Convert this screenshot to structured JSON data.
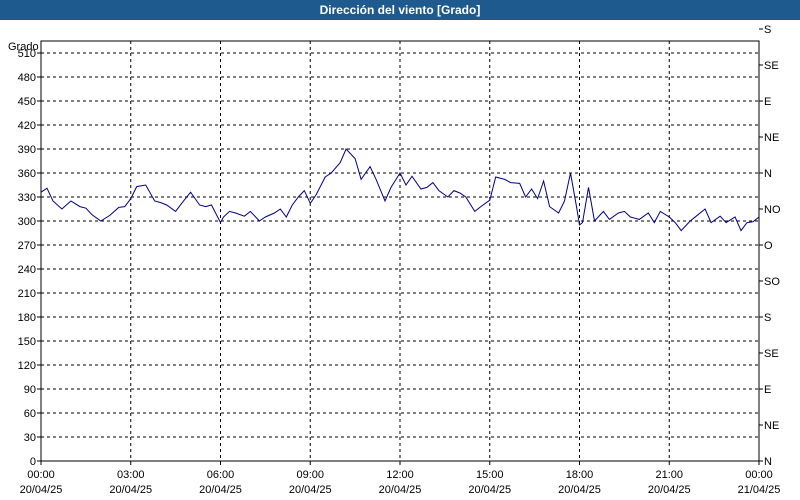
{
  "window": {
    "title": "Dirección del viento [Grado]"
  },
  "chart_data": {
    "type": "line",
    "title": "Dirección del viento [Grado]",
    "ylabel": "Grado",
    "ylim": [
      0,
      525
    ],
    "yticks": [
      0,
      30,
      60,
      90,
      120,
      150,
      180,
      210,
      240,
      270,
      300,
      330,
      360,
      390,
      420,
      450,
      480,
      510
    ],
    "right_ticks": [
      "N",
      "NE",
      "E",
      "SE",
      "S",
      "SO",
      "O",
      "NO",
      "N",
      "NE",
      "E",
      "SE",
      "S"
    ],
    "xlim": [
      "20/04/25 00:00",
      "21/04/25 00:00"
    ],
    "xticks": [
      {
        "time": "00:00",
        "date": "20/04/25"
      },
      {
        "time": "03:00",
        "date": "20/04/25"
      },
      {
        "time": "06:00",
        "date": "20/04/25"
      },
      {
        "time": "09:00",
        "date": "20/04/25"
      },
      {
        "time": "12:00",
        "date": "20/04/25"
      },
      {
        "time": "15:00",
        "date": "20/04/25"
      },
      {
        "time": "18:00",
        "date": "20/04/25"
      },
      {
        "time": "21:00",
        "date": "20/04/25"
      },
      {
        "time": "00:00",
        "date": "21/04/25"
      }
    ],
    "grid": true,
    "series": [
      {
        "color": "#00008b",
        "x_hours": [
          0,
          0.2,
          0.4,
          0.7,
          1.0,
          1.3,
          1.5,
          1.7,
          2.0,
          2.3,
          2.6,
          2.8,
          3.0,
          3.2,
          3.5,
          3.8,
          4.0,
          4.2,
          4.5,
          4.7,
          5.0,
          5.3,
          5.5,
          5.7,
          6.0,
          6.1,
          6.3,
          6.5,
          6.8,
          7.0,
          7.3,
          7.5,
          7.8,
          8.0,
          8.2,
          8.4,
          8.6,
          8.8,
          9.0,
          9.2,
          9.5,
          9.7,
          10.0,
          10.2,
          10.5,
          10.7,
          11.0,
          11.2,
          11.5,
          11.7,
          12.0,
          12.2,
          12.4,
          12.7,
          12.9,
          13.1,
          13.3,
          13.6,
          13.8,
          14.0,
          14.2,
          14.5,
          14.7,
          15.0,
          15.2,
          15.5,
          15.7,
          16.0,
          16.2,
          16.4,
          16.6,
          16.8,
          17.0,
          17.3,
          17.5,
          17.7,
          17.9,
          18.0,
          18.1,
          18.3,
          18.5,
          18.8,
          19.0,
          19.3,
          19.5,
          19.7,
          20.0,
          20.3,
          20.5,
          20.7,
          21.0,
          21.2,
          21.4,
          21.7,
          21.9,
          22.2,
          22.4,
          22.7,
          22.9,
          23.2,
          23.4,
          23.6,
          23.8,
          24.0
        ],
        "values": [
          336,
          341,
          325,
          315,
          325,
          318,
          316,
          308,
          300,
          307,
          317,
          318,
          328,
          343,
          345,
          325,
          323,
          320,
          312,
          322,
          336,
          320,
          318,
          320,
          298,
          305,
          312,
          310,
          306,
          312,
          300,
          305,
          310,
          315,
          305,
          320,
          330,
          338,
          322,
          333,
          355,
          360,
          373,
          390,
          378,
          352,
          368,
          352,
          325,
          342,
          360,
          345,
          356,
          340,
          342,
          348,
          338,
          330,
          338,
          335,
          330,
          312,
          318,
          326,
          355,
          352,
          348,
          347,
          330,
          340,
          328,
          350,
          318,
          310,
          325,
          360,
          318,
          295,
          298,
          342,
          300,
          312,
          302,
          310,
          312,
          305,
          302,
          310,
          298,
          312,
          305,
          298,
          288,
          300,
          306,
          315,
          298,
          306,
          298,
          305,
          288,
          298,
          299,
          305
        ]
      }
    ]
  }
}
